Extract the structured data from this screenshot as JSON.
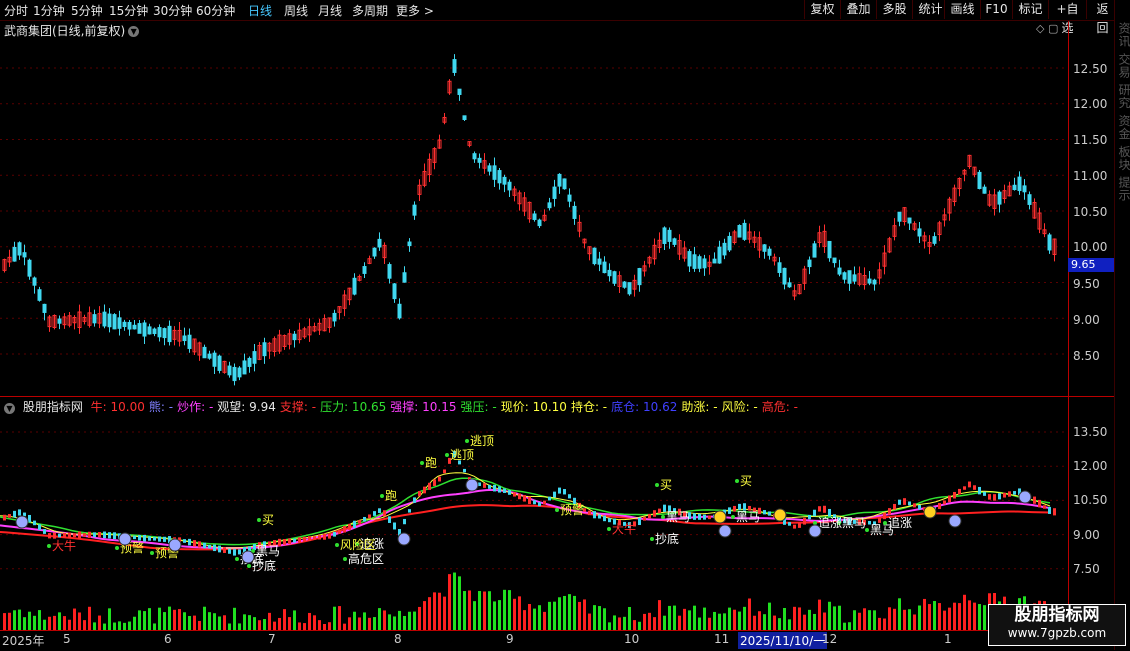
{
  "toolbar": {
    "periods": [
      "分时",
      "1分钟",
      "5分钟",
      "15分钟",
      "30分钟",
      "60分钟",
      "日线",
      "周线",
      "月线",
      "多周期",
      "更多 >"
    ],
    "active_period": "日线",
    "actions": [
      "复权",
      "叠加",
      "多股",
      "统计",
      "画线",
      "F10",
      "标记",
      "+自选",
      "返回"
    ]
  },
  "chart_title": "武商集团(日线,前复权)",
  "main_axis": {
    "ticks": [
      "12.50",
      "12.00",
      "11.50",
      "11.00",
      "10.50",
      "10.00",
      "9.50",
      "9.00",
      "8.50"
    ],
    "current_price": "9.65"
  },
  "indicator": {
    "name": "股朋指标网",
    "items": [
      {
        "label": "牛: 10.00",
        "color": "#ff3030"
      },
      {
        "label": "熊: -",
        "color": "#8080ff"
      },
      {
        "label": "炒作: -",
        "color": "#ff40ff"
      },
      {
        "label": "观望: 9.94",
        "color": "#e6e6e6"
      },
      {
        "label": "支撑: -",
        "color": "#ff3030"
      },
      {
        "label": "压力: 10.65",
        "color": "#30e030"
      },
      {
        "label": "强撑: 10.15",
        "color": "#ff40ff"
      },
      {
        "label": "强压: -",
        "color": "#30e030"
      },
      {
        "label": "现价: 10.10",
        "color": "#ffff40"
      },
      {
        "label": "持仓: -",
        "color": "#ffff40"
      },
      {
        "label": "底仓: 10.62",
        "color": "#4040ff"
      },
      {
        "label": "助涨: -",
        "color": "#ffff40"
      },
      {
        "label": "风险: -",
        "color": "#ffff40"
      },
      {
        "label": "高危: -",
        "color": "#ff3030"
      }
    ],
    "ticks": [
      "13.50",
      "12.00",
      "10.50",
      "9.00",
      "7.50"
    ]
  },
  "signals": [
    "逃顶",
    "跑",
    "逃顶",
    "跑",
    "买",
    "买",
    "买",
    "预警",
    "预警",
    "预警",
    "大牛",
    "大牛",
    "黑马",
    "黑马",
    "黑马",
    "黑马",
    "黑马",
    "抄底",
    "抄底",
    "抄底",
    "追涨",
    "追涨",
    "追涨",
    "高危区",
    "风险区"
  ],
  "x_axis": [
    "2025年",
    "5",
    "6",
    "7",
    "8",
    "9",
    "10",
    "11",
    "2025/11/10/一",
    "12",
    "1"
  ],
  "watermark": {
    "line1": "股朋指标网",
    "line2": "www.7gpzb.com"
  },
  "right_strip": "资讯 交易 研究 资金 板块 提示"
}
